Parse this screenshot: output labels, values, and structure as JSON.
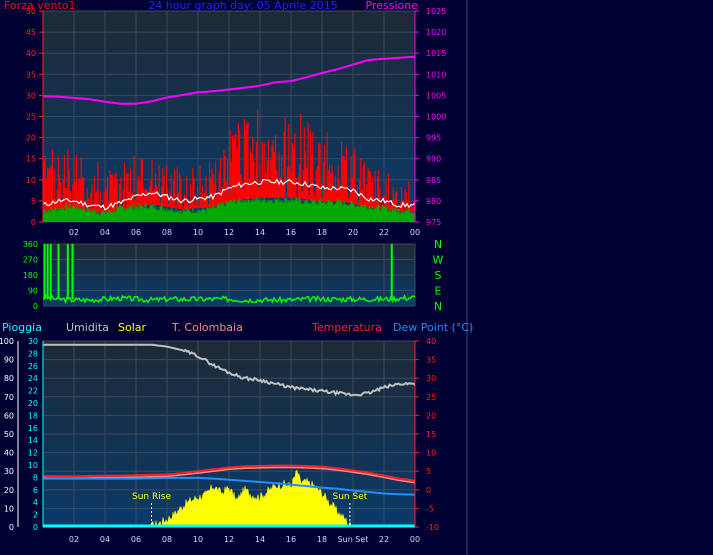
{
  "colors": {
    "background": "#000033",
    "plot_fill": "#1e2a36",
    "plot_fill_low": "#0a3a6a",
    "grid": "#3a4a5c",
    "wind_speed": "#ff0000",
    "wind_avg": "#ffffff",
    "wind_green": "#00aa00",
    "pressure": "#ff00ff",
    "title": "#2222ff",
    "direction": "#00ff00",
    "rain": "#00ffff",
    "humidity": "#c0c0c0",
    "solar": "#ffff00",
    "temperature": "#ff2222",
    "t_colombaia": "#ff8888",
    "dewpoint": "#1e90ff",
    "sun_label": "#ffff00"
  },
  "chart_data": [
    {
      "type": "line",
      "name": "wind-pressure",
      "title": "24 hour graph day:  05 Aprile 2015",
      "left_label": "Forza vento1",
      "right_label": "Pressione",
      "x_ticks": [
        "02",
        "04",
        "06",
        "08",
        "10",
        "12",
        "14",
        "16",
        "18",
        "20",
        "22",
        "00"
      ],
      "x_hours": [
        2,
        4,
        6,
        8,
        10,
        12,
        14,
        16,
        18,
        20,
        22,
        24
      ],
      "x_range": [
        0,
        24
      ],
      "y_left_ticks": [
        "0",
        "5",
        "10",
        "15",
        "20",
        "25",
        "30",
        "35",
        "40",
        "45",
        "50"
      ],
      "y_left_range": [
        0,
        50
      ],
      "y_right_ticks": [
        "975",
        "980",
        "985",
        "990",
        "995",
        "1000",
        "1005",
        "1010",
        "1015",
        "1020",
        "1025"
      ],
      "y_right_range": [
        975,
        1025
      ],
      "series": [
        {
          "key": "pressure",
          "axis": "right",
          "x": [
            0,
            1,
            2,
            3,
            4,
            5,
            6,
            7,
            8,
            9,
            10,
            11,
            12,
            13,
            14,
            15,
            16,
            17,
            18,
            19,
            20,
            21,
            22,
            23,
            24
          ],
          "values": [
            1004.8,
            1004.7,
            1004.4,
            1004.1,
            1003.5,
            1003,
            1003,
            1003.6,
            1004.5,
            1005.1,
            1005.7,
            1006,
            1006.4,
            1006.8,
            1007.3,
            1008.1,
            1008.4,
            1009.3,
            1010.3,
            1011.2,
            1012.3,
            1013.4,
            1013.7,
            1013.9,
            1014.2
          ]
        },
        {
          "key": "wind_envelope",
          "axis": "left",
          "x": [
            0,
            1,
            2,
            3,
            4,
            5,
            6,
            7,
            8,
            9,
            10,
            11,
            12,
            13,
            14,
            15,
            16,
            17,
            18,
            19,
            20,
            21,
            22,
            23,
            24
          ],
          "values": [
            16,
            18,
            17,
            14,
            12,
            15,
            18,
            17,
            15,
            12,
            14,
            15,
            22,
            25,
            24,
            22,
            27,
            25,
            22,
            20,
            18,
            14,
            12,
            11,
            10
          ]
        },
        {
          "key": "wind_avg",
          "axis": "left",
          "x": [
            0,
            1,
            2,
            3,
            4,
            5,
            6,
            7,
            8,
            9,
            10,
            11,
            12,
            13,
            14,
            15,
            16,
            17,
            18,
            19,
            20,
            21,
            22,
            23,
            24
          ],
          "values": [
            4,
            5,
            5,
            4,
            3.5,
            4.5,
            6,
            7,
            6,
            5,
            5.5,
            6,
            8,
            9,
            9.5,
            9.5,
            9.5,
            9,
            8,
            8,
            7.5,
            5.5,
            5,
            4,
            4
          ]
        },
        {
          "key": "wind_green",
          "axis": "left",
          "x": [
            0,
            1,
            2,
            3,
            4,
            5,
            6,
            7,
            8,
            9,
            10,
            11,
            12,
            13,
            14,
            15,
            16,
            17,
            18,
            19,
            20,
            21,
            22,
            23,
            24
          ],
          "values": [
            2,
            2.5,
            3,
            2,
            1.5,
            2.5,
            3,
            3,
            2.5,
            2,
            2,
            2.5,
            4,
            4.5,
            4.5,
            4.5,
            4.5,
            4,
            4,
            4,
            3.5,
            3,
            2.5,
            2,
            2
          ]
        }
      ]
    },
    {
      "type": "line",
      "name": "wind-direction",
      "right_labels": [
        "N",
        "W",
        "S",
        "E",
        "N"
      ],
      "y_ticks": [
        "360",
        "270",
        "180",
        "90",
        "0"
      ],
      "y_range": [
        0,
        360
      ],
      "x_range": [
        0,
        24
      ],
      "series": [
        {
          "key": "direction",
          "x": [
            0,
            1,
            2,
            3,
            4,
            5,
            6,
            7,
            8,
            9,
            10,
            11,
            12,
            13,
            14,
            15,
            16,
            17,
            18,
            19,
            20,
            21,
            22,
            23,
            24
          ],
          "values": [
            50,
            40,
            35,
            35,
            40,
            45,
            40,
            35,
            40,
            40,
            40,
            40,
            40,
            35,
            35,
            35,
            35,
            40,
            40,
            40,
            40,
            40,
            40,
            45,
            50
          ]
        }
      ],
      "spikes": [
        0.1,
        0.3,
        0.5,
        1.0,
        1.6,
        1.9,
        22.5
      ]
    },
    {
      "type": "line",
      "name": "temperature-humidity-solar",
      "legend": [
        "Pioggia",
        "Umidita",
        "Solar",
        "T. Colombaia",
        "Temperatura",
        "Dew Point (°C)"
      ],
      "x_ticks": [
        "02",
        "04",
        "06",
        "08",
        "10",
        "12",
        "14",
        "16",
        "18",
        "Sun Set",
        "22",
        "00"
      ],
      "x_hours": [
        2,
        4,
        6,
        8,
        10,
        12,
        14,
        16,
        18,
        20,
        22,
        24
      ],
      "x_range": [
        0,
        24
      ],
      "y_far_left_ticks": [
        "0",
        "10",
        "20",
        "30",
        "40",
        "50",
        "60",
        "70",
        "80",
        "90",
        "100"
      ],
      "y_left_ticks": [
        "0",
        "2",
        "4",
        "6",
        "8",
        "10",
        "12",
        "14",
        "16",
        "18",
        "20",
        "22",
        "24",
        "26",
        "28",
        "30"
      ],
      "y_right_ticks": [
        "-10",
        "-5",
        "0",
        "5",
        "10",
        "15",
        "20",
        "25",
        "30",
        "35",
        "40"
      ],
      "y_right_range": [
        -10,
        40
      ],
      "sun_rise_label": "Sun Rise",
      "sun_set_label": "Sun Set",
      "sun_rise_hour": 7,
      "sun_set_hour": 19.8,
      "series": [
        {
          "key": "humidity",
          "axis": "far_left",
          "x": [
            0,
            1,
            2,
            3,
            4,
            5,
            6,
            7,
            8,
            9,
            10,
            11,
            12,
            13,
            14,
            15,
            16,
            17,
            18,
            19,
            20,
            21,
            22,
            23,
            24
          ],
          "values": [
            98,
            98,
            98,
            98,
            98,
            98,
            98,
            98,
            97,
            95,
            92,
            87,
            83,
            80,
            79,
            77,
            75,
            74,
            73,
            72,
            71,
            72,
            75,
            77,
            77
          ]
        },
        {
          "key": "temperature",
          "axis": "right",
          "x": [
            0,
            1,
            2,
            3,
            4,
            5,
            6,
            7,
            8,
            9,
            10,
            11,
            12,
            13,
            14,
            15,
            16,
            17,
            18,
            19,
            20,
            21,
            22,
            23,
            24
          ],
          "values": [
            3.7,
            3.6,
            3.6,
            3.7,
            3.8,
            3.8,
            3.9,
            4,
            4.1,
            4.5,
            5,
            5.5,
            6,
            6.3,
            6.4,
            6.5,
            6.5,
            6.4,
            6.2,
            5.8,
            5.2,
            4.6,
            3.8,
            3,
            2.4
          ]
        },
        {
          "key": "t_colombaia",
          "axis": "right",
          "x": [
            0,
            1,
            2,
            3,
            4,
            5,
            6,
            7,
            8,
            9,
            10,
            11,
            12,
            13,
            14,
            15,
            16,
            17,
            18,
            19,
            20,
            21,
            22,
            23,
            24
          ],
          "values": [
            3.2,
            3.1,
            3.1,
            3.2,
            3.3,
            3.3,
            3.4,
            3.5,
            3.6,
            4,
            4.5,
            5,
            5.5,
            5.8,
            5.9,
            6,
            6,
            5.9,
            5.7,
            5.3,
            4.7,
            4.1,
            3.3,
            2.5,
            1.9
          ]
        },
        {
          "key": "dewpoint",
          "axis": "right",
          "x": [
            0,
            1,
            2,
            3,
            4,
            5,
            6,
            7,
            8,
            9,
            10,
            11,
            12,
            13,
            14,
            15,
            16,
            17,
            18,
            19,
            20,
            21,
            22,
            23,
            24
          ],
          "values": [
            3,
            3,
            3,
            3,
            3,
            3,
            3,
            3.1,
            3.2,
            3.2,
            3.2,
            3,
            2.7,
            2.4,
            2.1,
            1.8,
            1.4,
            1,
            0.6,
            0.3,
            -0.2,
            -0.6,
            -1,
            -1.2,
            -1.3
          ]
        },
        {
          "key": "rain",
          "axis": "left",
          "x": [
            0,
            24
          ],
          "values": [
            0,
            0
          ]
        },
        {
          "key": "solar",
          "axis": "far_left",
          "x": [
            0,
            6.8,
            7.2,
            8,
            8.5,
            9,
            9.5,
            10,
            10.5,
            11,
            11.5,
            12,
            12.5,
            13,
            13.5,
            14,
            14.5,
            15,
            15.5,
            16,
            16.4,
            16.6,
            17,
            17.5,
            18,
            18.5,
            19,
            19.5,
            19.8,
            20
          ],
          "values": [
            0,
            0,
            1,
            4,
            7,
            11,
            14,
            16,
            17,
            22,
            18,
            21,
            14,
            20,
            17,
            16,
            19,
            22,
            23,
            22,
            30,
            24,
            24,
            22,
            18,
            13,
            8,
            4,
            1,
            0
          ]
        }
      ]
    }
  ]
}
